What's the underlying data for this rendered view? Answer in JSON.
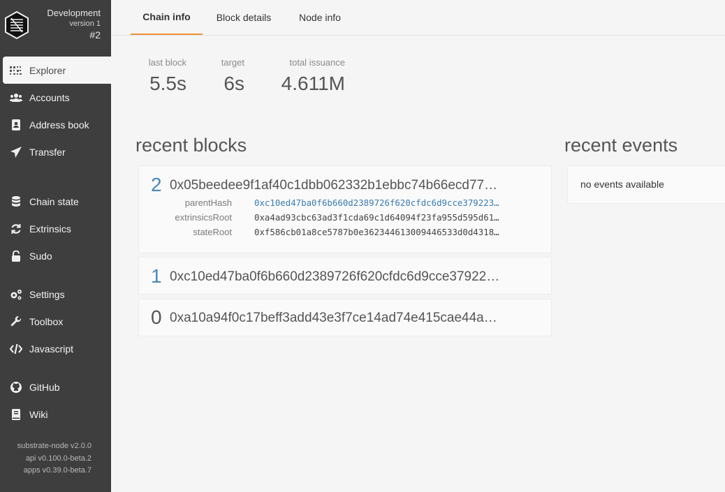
{
  "chain": {
    "name": "Development",
    "version": "version 1",
    "number": "#2"
  },
  "sidebar": {
    "items": [
      {
        "label": "Explorer",
        "icon": "grid-icon",
        "active": true
      },
      {
        "label": "Accounts",
        "icon": "users-icon"
      },
      {
        "label": "Address book",
        "icon": "address-book-icon"
      },
      {
        "label": "Transfer",
        "icon": "send-icon"
      },
      {
        "label": "Chain state",
        "icon": "database-icon"
      },
      {
        "label": "Extrinsics",
        "icon": "sync-icon"
      },
      {
        "label": "Sudo",
        "icon": "unlock-icon"
      },
      {
        "label": "Settings",
        "icon": "cogs-icon"
      },
      {
        "label": "Toolbox",
        "icon": "wrench-icon"
      },
      {
        "label": "Javascript",
        "icon": "code-icon"
      },
      {
        "label": "GitHub",
        "icon": "github-icon"
      },
      {
        "label": "Wiki",
        "icon": "book-icon"
      }
    ],
    "versions": [
      "substrate-node v2.0.0",
      "api v0.100.0-beta.2",
      "apps v0.39.0-beta.7"
    ]
  },
  "tabs": [
    {
      "label": "Chain info",
      "active": true
    },
    {
      "label": "Block details"
    },
    {
      "label": "Node info"
    }
  ],
  "summary": {
    "last_block": {
      "label": "last block",
      "value": "5.5s"
    },
    "target": {
      "label": "target",
      "value": "6s"
    },
    "total_issuance": {
      "label": "total issuance",
      "value": "4.611M"
    }
  },
  "recent_blocks": {
    "title": "recent blocks",
    "blocks": [
      {
        "number": "2",
        "hash": "0x05beedee9f1af40c1dbb062332b1ebbc74b66ecd77…",
        "details": [
          {
            "label": "parentHash",
            "value": "0xc10ed47ba0f6b660d2389726f620cfdc6d9cce379223…"
          },
          {
            "label": "extrinsicsRoot",
            "value": "0xa4ad93cbc63ad3f1cda69c1d64094f23fa955d595d61…"
          },
          {
            "label": "stateRoot",
            "value": "0xf586cb01a8ce5787b0e362344613009446533d0d4318…"
          }
        ]
      },
      {
        "number": "1",
        "hash": "0xc10ed47ba0f6b660d2389726f620cfdc6d9cce37922…"
      },
      {
        "number": "0",
        "hash": "0xa10a94f0c17beff3add43e3f7ce14ad74e415cae44a…"
      }
    ]
  },
  "recent_events": {
    "title": "recent events",
    "empty_text": "no events available"
  },
  "colors": {
    "sidebar_bg": "#3e3e3e",
    "accent": "#f19135",
    "link": "#3a7cb0",
    "block_number_blue": "#4a87bb"
  }
}
